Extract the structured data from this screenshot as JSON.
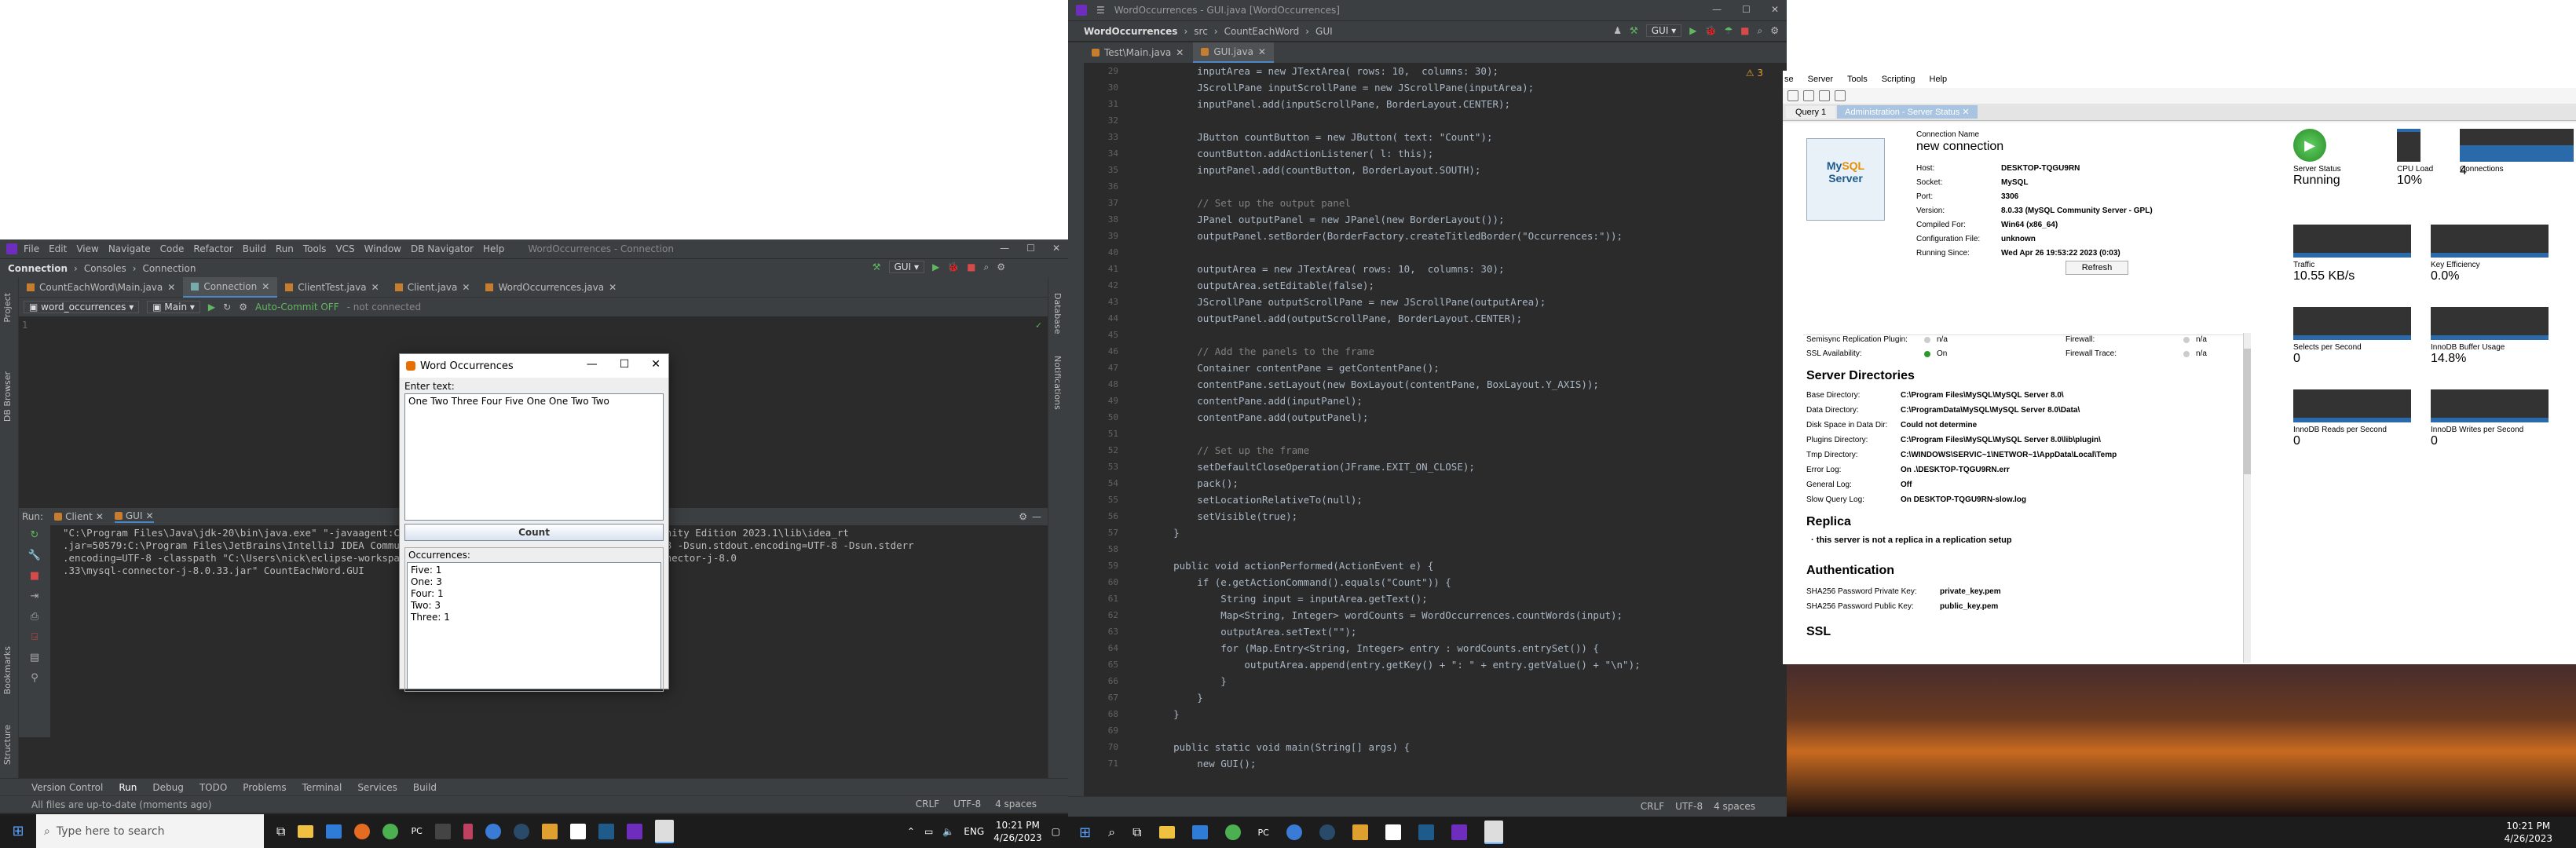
{
  "left_ide": {
    "menu": [
      "File",
      "Edit",
      "View",
      "Navigate",
      "Code",
      "Refactor",
      "Build",
      "Run",
      "Tools",
      "VCS",
      "Window",
      "DB Navigator",
      "Help"
    ],
    "title": "WordOccurrences - Connection",
    "breadcrumbs": [
      "Connection",
      "Consoles",
      "Connection"
    ],
    "run_config": "GUI",
    "tabs": [
      "CountEachWord\\Main.java",
      "Connection",
      "ClientTest.java",
      "Client.java",
      "WordOccurrences.java"
    ],
    "conn_select": "word_occurrences",
    "schema_select": "Main",
    "autocommit": "Auto-Commit OFF",
    "conn_status": "- not connected",
    "line_num": "1",
    "run_label": "Run:",
    "run_tabs": [
      "Client",
      "GUI"
    ],
    "console_lines": [
      "\"C:\\Program Files\\Java\\jdk-20\\bin\\java.exe\" \"-javaagent:C:\\Program Files\\JetBrains\\IntelliJ IDEA Community Edition 2023.1\\lib\\idea_rt",
      ".jar=50579:C:\\Program Files\\JetBrains\\IntelliJ IDEA Community Edition 2023.1\\bin\" -Dfile.encoding=UTF-8 -Dsun.stdout.encoding=UTF-8 -Dsun.stderr",
      ".encoding=UTF-8 -classpath \"C:\\Users\\nick\\eclipse-workspace\\WordOccurrences;C:\\Program Files\\MySQL\\connector-j-8.0",
      ".33\\mysql-connector-j-8.0.33.jar\" CountEachWord.GUI"
    ],
    "bottom_tabs": [
      "Version Control",
      "Run",
      "Debug",
      "TODO",
      "Problems",
      "Terminal",
      "Services",
      "Build"
    ],
    "status_msg": "All files are up-to-date (moments ago)",
    "status_right": [
      "CRLF",
      "UTF-8",
      "4 spaces"
    ],
    "side_tabs": [
      "Project",
      "DB Browser",
      "Bookmarks",
      "Structure"
    ],
    "right_side_tabs": [
      "Database",
      "Notifications"
    ]
  },
  "swing": {
    "title": "Word Occurrences",
    "enter_label": "Enter text:",
    "input_text": "One Two Three Four Five One One Two Two",
    "button": "Count",
    "occ_label": "Occurrences:",
    "results": [
      "Five: 1",
      "One: 3",
      "Four: 1",
      "Two: 3",
      "Three: 1"
    ]
  },
  "right_ide": {
    "title": "WordOccurrences - GUI.java [WordOccurrences]",
    "breadcrumbs": [
      "WordOccurrences",
      "src",
      "CountEachWord",
      "GUI"
    ],
    "run_config": "GUI",
    "tabs": [
      "Test\\Main.java",
      "GUI.java"
    ],
    "warnings": "3",
    "lines": [
      {
        "n": "29",
        "c": "        inputArea = new JTextArea( rows: 10,  columns: 30);"
      },
      {
        "n": "30",
        "c": "        JScrollPane inputScrollPane = new JScrollPane(inputArea);"
      },
      {
        "n": "31",
        "c": "        inputPanel.add(inputScrollPane, BorderLayout.CENTER);"
      },
      {
        "n": "32",
        "c": ""
      },
      {
        "n": "33",
        "c": "        JButton countButton = new JButton( text: \"Count\");"
      },
      {
        "n": "34",
        "c": "        countButton.addActionListener( l: this);"
      },
      {
        "n": "35",
        "c": "        inputPanel.add(countButton, BorderLayout.SOUTH);"
      },
      {
        "n": "36",
        "c": ""
      },
      {
        "n": "37",
        "c": "        // Set up the output panel"
      },
      {
        "n": "38",
        "c": "        JPanel outputPanel = new JPanel(new BorderLayout());"
      },
      {
        "n": "39",
        "c": "        outputPanel.setBorder(BorderFactory.createTitledBorder(\"Occurrences:\"));"
      },
      {
        "n": "40",
        "c": ""
      },
      {
        "n": "41",
        "c": "        outputArea = new JTextArea( rows: 10,  columns: 30);"
      },
      {
        "n": "42",
        "c": "        outputArea.setEditable(false);"
      },
      {
        "n": "43",
        "c": "        JScrollPane outputScrollPane = new JScrollPane(outputArea);"
      },
      {
        "n": "44",
        "c": "        outputPanel.add(outputScrollPane, BorderLayout.CENTER);"
      },
      {
        "n": "45",
        "c": ""
      },
      {
        "n": "46",
        "c": "        // Add the panels to the frame"
      },
      {
        "n": "47",
        "c": "        Container contentPane = getContentPane();"
      },
      {
        "n": "48",
        "c": "        contentPane.setLayout(new BoxLayout(contentPane, BoxLayout.Y_AXIS));"
      },
      {
        "n": "49",
        "c": "        contentPane.add(inputPanel);"
      },
      {
        "n": "50",
        "c": "        contentPane.add(outputPanel);"
      },
      {
        "n": "51",
        "c": ""
      },
      {
        "n": "52",
        "c": "        // Set up the frame"
      },
      {
        "n": "53",
        "c": "        setDefaultCloseOperation(JFrame.EXIT_ON_CLOSE);"
      },
      {
        "n": "54",
        "c": "        pack();"
      },
      {
        "n": "55",
        "c": "        setLocationRelativeTo(null);"
      },
      {
        "n": "56",
        "c": "        setVisible(true);"
      },
      {
        "n": "57",
        "c": "    }"
      },
      {
        "n": "58",
        "c": ""
      },
      {
        "n": "59",
        "c": "    public void actionPerformed(ActionEvent e) {"
      },
      {
        "n": "60",
        "c": "        if (e.getActionCommand().equals(\"Count\")) {"
      },
      {
        "n": "61",
        "c": "            String input = inputArea.getText();"
      },
      {
        "n": "62",
        "c": "            Map<String, Integer> wordCounts = WordOccurrences.countWords(input);"
      },
      {
        "n": "63",
        "c": "            outputArea.setText(\"\");"
      },
      {
        "n": "64",
        "c": "            for (Map.Entry<String, Integer> entry : wordCounts.entrySet()) {"
      },
      {
        "n": "65",
        "c": "                outputArea.append(entry.getKey() + \": \" + entry.getValue() + \"\\n\");"
      },
      {
        "n": "66",
        "c": "            }"
      },
      {
        "n": "67",
        "c": "        }"
      },
      {
        "n": "68",
        "c": "    }"
      },
      {
        "n": "69",
        "c": ""
      },
      {
        "n": "70",
        "c": "    public static void main(String[] args) {"
      },
      {
        "n": "71",
        "c": "        new GUI();"
      }
    ],
    "status_right": [
      "CRLF",
      "UTF-8",
      "4 spaces"
    ]
  },
  "workbench": {
    "menu": [
      "se",
      "Server",
      "Tools",
      "Scripting",
      "Help"
    ],
    "tabs": [
      "Query 1",
      "Administration - Server Status"
    ],
    "conn_name_label": "Connection Name",
    "conn_name": "new connection",
    "info": [
      [
        "Host:",
        "DESKTOP-TQGU9RN"
      ],
      [
        "Socket:",
        "MySQL"
      ],
      [
        "Port:",
        "3306"
      ],
      [
        "Version:",
        "8.0.33 (MySQL Community Server - GPL)"
      ],
      [
        "Compiled For:",
        "Win64  (x86_64)"
      ],
      [
        "Configuration File:",
        "unknown"
      ],
      [
        "Running Since:",
        "Wed Apr 26 19:53:22 2023 (0:03)"
      ]
    ],
    "refresh": "Refresh",
    "status_metrics": [
      {
        "label": "Server Status",
        "value": "Running"
      },
      {
        "label": "CPU Load",
        "value": "10%"
      },
      {
        "label": "Connections",
        "value": "4"
      }
    ],
    "metrics": [
      {
        "label": "Traffic",
        "value": "10.55 KB/s"
      },
      {
        "label": "Key Efficiency",
        "value": "0.0%"
      },
      {
        "label": "Selects per Second",
        "value": "0"
      },
      {
        "label": "InnoDB Buffer Usage",
        "value": "14.8%"
      },
      {
        "label": "InnoDB Reads per Second",
        "value": "0"
      },
      {
        "label": "InnoDB Writes per Second",
        "value": "0"
      }
    ],
    "features": [
      [
        "Semisync Replication Plugin:",
        "n/a",
        "Firewall:",
        "n/a"
      ],
      [
        "SSL Availability:",
        "On",
        "Firewall Trace:",
        "n/a"
      ]
    ],
    "dirs_title": "Server Directories",
    "dirs": [
      [
        "Base Directory:",
        "C:\\Program Files\\MySQL\\MySQL Server 8.0\\"
      ],
      [
        "Data Directory:",
        "C:\\ProgramData\\MySQL\\MySQL Server 8.0\\Data\\"
      ],
      [
        "Disk Space in Data Dir:",
        "Could not determine"
      ],
      [
        "Plugins Directory:",
        "C:\\Program Files\\MySQL\\MySQL Server 8.0\\lib\\plugin\\"
      ],
      [
        "Tmp Directory:",
        "C:\\WINDOWS\\SERVIC~1\\NETWOR~1\\AppData\\Local\\Temp"
      ],
      [
        "Error Log:",
        "On   .\\DESKTOP-TQGU9RN.err"
      ],
      [
        "General Log:",
        "Off"
      ],
      [
        "Slow Query Log:",
        "On   DESKTOP-TQGU9RN-slow.log"
      ]
    ],
    "replica_title": "Replica",
    "replica_text": "this server is not a replica in a replication setup",
    "auth_title": "Authentication",
    "auth": [
      [
        "SHA256 Password Private Key:",
        "private_key.pem"
      ],
      [
        "SHA256 Password Public Key:",
        "public_key.pem"
      ]
    ],
    "ssl_title": "SSL"
  },
  "taskbar_left": {
    "search": "Type here to search",
    "lang": "ENG",
    "time": "10:21 PM",
    "date": "4/26/2023"
  },
  "taskbar_right": {
    "time": "10:21 PM",
    "date": "4/26/2023"
  }
}
